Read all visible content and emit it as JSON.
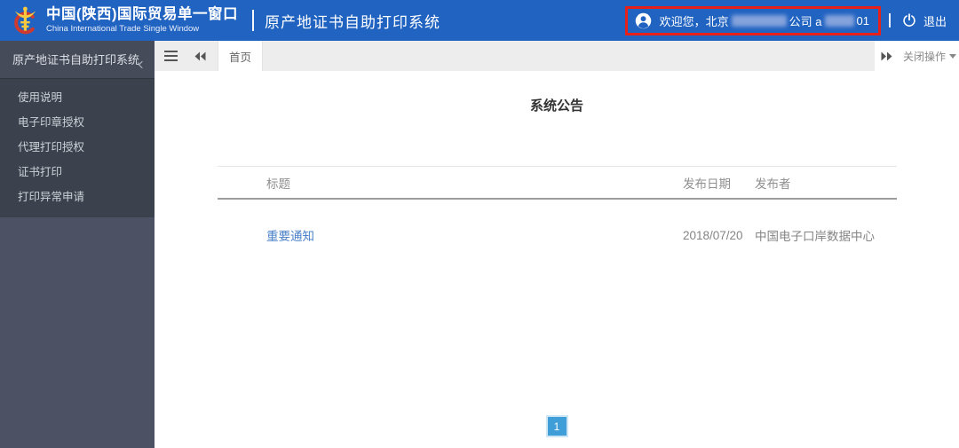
{
  "header": {
    "brand_title": "中国(陕西)国际贸易单一窗口",
    "brand_subtitle": "China International Trade Single Window",
    "app_title": "原产地证书自助打印系统",
    "user": {
      "welcome_text": "欢迎您，北京",
      "company_label": "公司 a",
      "account_suffix": "01"
    },
    "logout_label": "退出"
  },
  "sidebar": {
    "title": "原产地证书自助打印系统",
    "items": [
      {
        "label": "使用说明"
      },
      {
        "label": "电子印章授权"
      },
      {
        "label": "代理打印授权"
      },
      {
        "label": "证书打印"
      },
      {
        "label": "打印异常申请"
      }
    ]
  },
  "tabbar": {
    "tabs": [
      {
        "label": "首页",
        "active": true
      }
    ],
    "close_menu_label": "关闭操作"
  },
  "main": {
    "title": "系统公告",
    "table": {
      "columns": [
        "标题",
        "发布日期",
        "发布者"
      ],
      "rows": [
        {
          "title": "重要通知",
          "date": "2018/07/20",
          "publisher": "中国电子口岸数据中心"
        }
      ]
    },
    "pagination": {
      "current_page": "1"
    }
  },
  "colors": {
    "header_blue": "#2163c1",
    "annotation_red": "#e8201a",
    "sidebar_dark": "#3b414d",
    "sidebar_light": "#4c5263",
    "link_blue": "#4a80c8",
    "pagination_blue": "#3f9dd8",
    "tabbar_gray": "#ededed"
  }
}
